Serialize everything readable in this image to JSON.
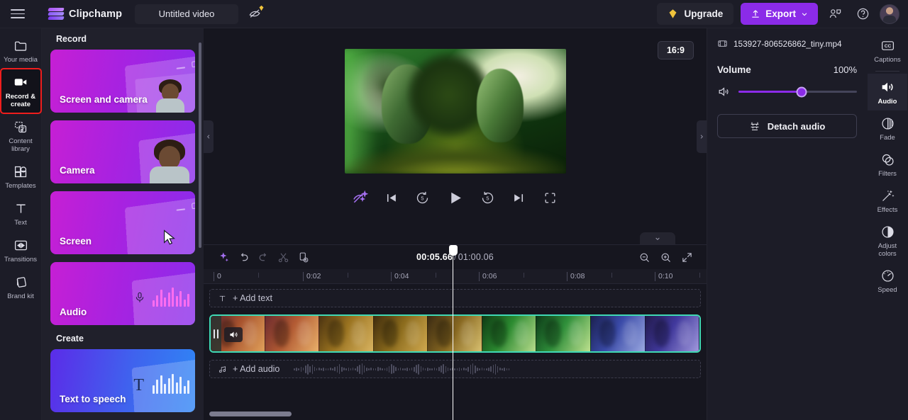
{
  "header": {
    "menu_icon": "hamburger-menu-icon",
    "brand": "Clipchamp",
    "project_title": "Untitled video",
    "magic_icon": "magic-eraser-premium-icon",
    "upgrade_label": "Upgrade",
    "upgrade_icon": "diamond-icon",
    "export_label": "Export",
    "export_icon": "upload-icon",
    "export_chevron": "chevron-down-icon",
    "collaborate_icon": "collaborate-icon",
    "help_icon": "help-circle-icon",
    "avatar_icon": "user-avatar",
    "accent_purple": "#8b2be8",
    "upgrade_gold": "#f0c33c"
  },
  "left_rail": {
    "items": [
      {
        "label": "Your media",
        "icon": "folder-icon",
        "active": false,
        "highlighted": false
      },
      {
        "label": "Record & create",
        "icon": "video-camera-icon",
        "active": true,
        "highlighted": true
      },
      {
        "label": "Content library",
        "icon": "content-library-icon",
        "active": false,
        "highlighted": false
      },
      {
        "label": "Templates",
        "icon": "templates-icon",
        "active": false,
        "highlighted": false
      },
      {
        "label": "Text",
        "icon": "text-icon",
        "active": false,
        "highlighted": false
      },
      {
        "label": "Transitions",
        "icon": "transitions-icon",
        "active": false,
        "highlighted": false
      },
      {
        "label": "Brand kit",
        "icon": "brand-kit-icon",
        "active": false,
        "highlighted": false
      }
    ],
    "highlight_color": "#ef1d1d"
  },
  "panel": {
    "record_heading": "Record",
    "create_heading": "Create",
    "record_cards": [
      {
        "label": "Screen and camera",
        "art": "screen-and-camera"
      },
      {
        "label": "Camera",
        "art": "camera"
      },
      {
        "label": "Screen",
        "art": "screen"
      },
      {
        "label": "Audio",
        "art": "audio"
      }
    ],
    "create_cards": [
      {
        "label": "Text to speech",
        "art": "text-to-speech"
      }
    ]
  },
  "preview": {
    "aspect_ratio": "16:9",
    "collapse_left_icon": "chevron-left-icon",
    "collapse_right_icon": "chevron-right-icon",
    "timeline_collapse_icon": "chevron-down-icon",
    "controls": [
      {
        "name": "magic-eraser-button",
        "icon": "magic-eraser-icon"
      },
      {
        "name": "skip-to-start-button",
        "icon": "skip-previous-icon"
      },
      {
        "name": "rewind-5s-button",
        "icon": "replay-5-icon"
      },
      {
        "name": "play-button",
        "icon": "play-icon"
      },
      {
        "name": "forward-5s-button",
        "icon": "forward-5-icon"
      },
      {
        "name": "skip-to-end-button",
        "icon": "skip-next-icon"
      },
      {
        "name": "fullscreen-button",
        "icon": "fullscreen-icon"
      }
    ]
  },
  "timeline": {
    "toolbar": [
      {
        "name": "ai-suggest-button",
        "icon": "sparkle-icon",
        "enabled": true
      },
      {
        "name": "undo-button",
        "icon": "undo-icon",
        "enabled": true
      },
      {
        "name": "redo-button",
        "icon": "redo-icon",
        "enabled": false
      },
      {
        "name": "split-button",
        "icon": "scissors-icon",
        "enabled": false
      },
      {
        "name": "duplicate-button",
        "icon": "duplicate-icon",
        "enabled": true
      }
    ],
    "current_time": "00:05.66",
    "separator": "/",
    "total_time": "01:00.06",
    "zoom_out_icon": "zoom-out-icon",
    "zoom_in_icon": "zoom-in-icon",
    "fit_icon": "fit-to-screen-icon",
    "ruler_labels": [
      "0",
      "0:02",
      "0:04",
      "0:06",
      "0:08",
      "0:10"
    ],
    "add_text_label": "+ Add text",
    "add_text_icon": "text-icon",
    "add_audio_label": "+ Add audio",
    "add_audio_icon": "music-note-icon",
    "clip_selected": true,
    "clip_border_color": "#3fd9b4",
    "clip_audio_icon": "speaker-icon",
    "clip_drag_handle": "drag-handle",
    "playhead_position_pct": 49.5
  },
  "properties": {
    "file_icon": "film-icon",
    "file_name": "153927-806526862_tiny.mp4",
    "volume_label": "Volume",
    "volume_value": "100%",
    "volume_icon": "speaker-icon",
    "slider_pct": 53,
    "detach_label": "Detach audio",
    "detach_icon": "detach-icon"
  },
  "right_rail": {
    "items": [
      {
        "label": "Captions",
        "icon": "closed-caption-icon",
        "active": false
      },
      {
        "label": "Audio",
        "icon": "speaker-icon",
        "active": true
      },
      {
        "label": "Fade",
        "icon": "fade-icon",
        "active": false
      },
      {
        "label": "Filters",
        "icon": "filters-icon",
        "active": false
      },
      {
        "label": "Effects",
        "icon": "effects-wand-icon",
        "active": false
      },
      {
        "label": "Adjust colors",
        "icon": "adjust-colors-icon",
        "active": false
      },
      {
        "label": "Speed",
        "icon": "speedometer-icon",
        "active": false
      }
    ]
  }
}
